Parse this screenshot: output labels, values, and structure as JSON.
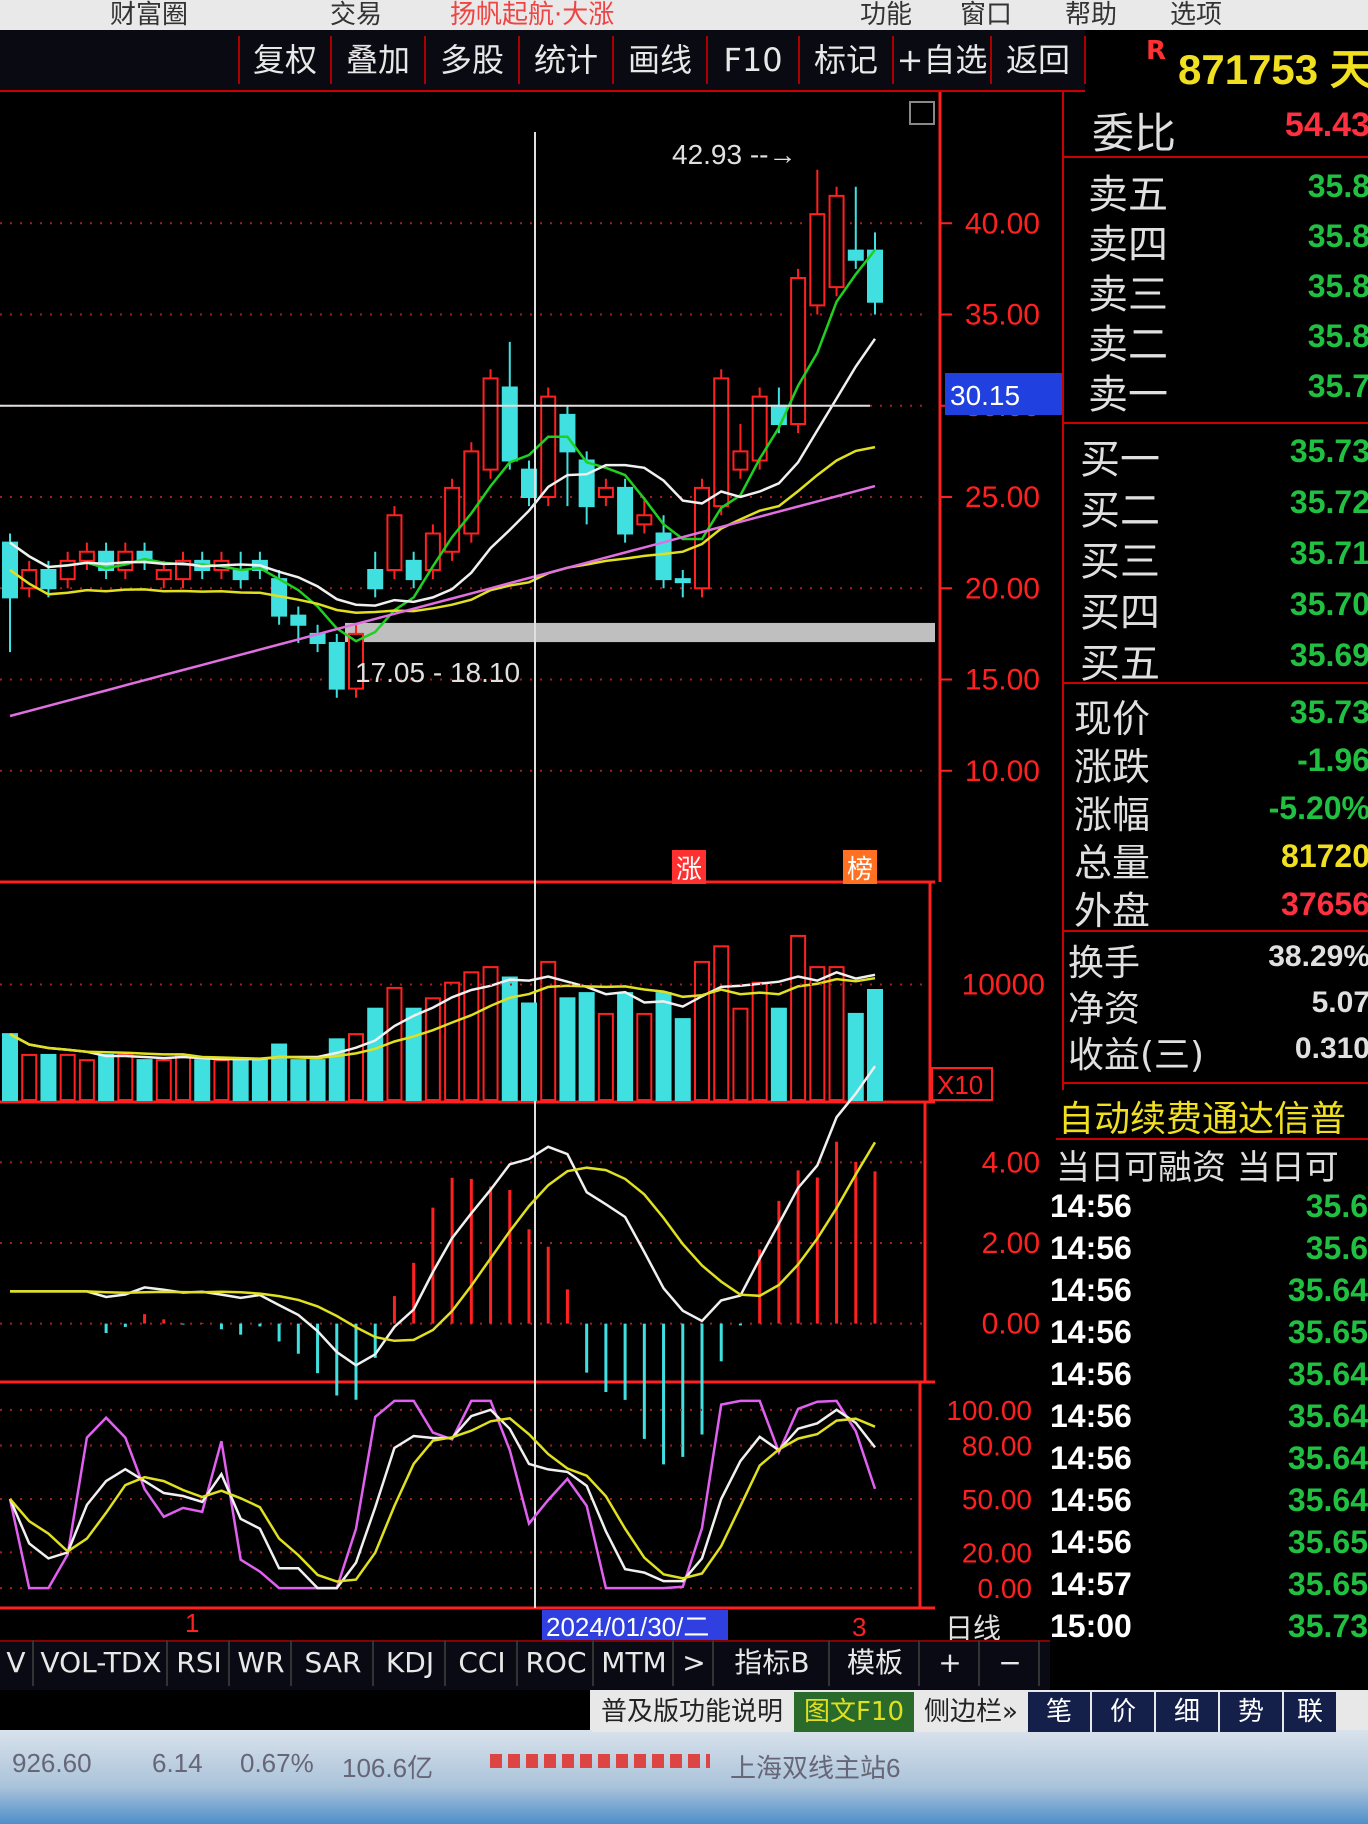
{
  "top_menu": [
    "财富圈",
    "交易",
    "扬帆起航·大涨",
    "功能",
    "窗口",
    "帮助",
    "选项"
  ],
  "toolbar": [
    "复权",
    "叠加",
    "多股",
    "统计",
    "画线",
    "F10",
    "标记",
    "+自选",
    "返回"
  ],
  "stock": {
    "marker": "R",
    "code_name": "871753 天"
  },
  "quote": {
    "weibi_label": "委比",
    "weibi_value": "54.43",
    "sell": [
      {
        "label": "卖五",
        "price": "35.8"
      },
      {
        "label": "卖四",
        "price": "35.8"
      },
      {
        "label": "卖三",
        "price": "35.8"
      },
      {
        "label": "卖二",
        "price": "35.8"
      },
      {
        "label": "卖一",
        "price": "35.7"
      }
    ],
    "buy": [
      {
        "label": "买一",
        "price": "35.73"
      },
      {
        "label": "买二",
        "price": "35.72"
      },
      {
        "label": "买三",
        "price": "35.71"
      },
      {
        "label": "买四",
        "price": "35.70"
      },
      {
        "label": "买五",
        "price": "35.69"
      }
    ],
    "stats": [
      {
        "label": "现价",
        "value": "35.73",
        "color": "#20c040"
      },
      {
        "label": "涨跌",
        "value": "-1.96",
        "color": "#20c040"
      },
      {
        "label": "涨幅",
        "value": "-5.20%",
        "color": "#20c040"
      },
      {
        "label": "总量",
        "value": "81720",
        "color": "#f0e020"
      },
      {
        "label": "外盘",
        "value": "37656",
        "color": "#ff3040"
      }
    ],
    "stats2": [
      {
        "label": "换手",
        "value": "38.29%"
      },
      {
        "label": "净资",
        "value": "5.07"
      },
      {
        "label": "收益(三)",
        "value": "0.310"
      }
    ],
    "banner": "自动续费通达信普",
    "margin_label": "当日可融资 当日可"
  },
  "ticks": [
    {
      "time": "14:56",
      "price": "35.6"
    },
    {
      "time": "14:56",
      "price": "35.6"
    },
    {
      "time": "14:56",
      "price": "35.64"
    },
    {
      "time": "14:56",
      "price": "35.65"
    },
    {
      "time": "14:56",
      "price": "35.64"
    },
    {
      "time": "14:56",
      "price": "35.64"
    },
    {
      "time": "14:56",
      "price": "35.64"
    },
    {
      "time": "14:56",
      "price": "35.64"
    },
    {
      "time": "14:56",
      "price": "35.65"
    },
    {
      "time": "14:57",
      "price": "35.65"
    },
    {
      "time": "15:00",
      "price": "35.73"
    }
  ],
  "chart_data": [
    {
      "type": "candlestick",
      "title": "日线",
      "price_axis": [
        "40.00",
        "35.00",
        "30.00",
        "25.00",
        "20.00",
        "15.00",
        "10.00"
      ],
      "highlight_price": "30.15",
      "peak_label": "42.93",
      "range_label": "17.05 - 18.10",
      "markers": [
        "涨",
        "榜"
      ],
      "candles": [
        {
          "o": 19.5,
          "c": 22.5,
          "h": 23,
          "l": 16.5,
          "up": false
        },
        {
          "o": 20.0,
          "c": 21.0,
          "h": 21.5,
          "l": 19.5,
          "up": true
        },
        {
          "o": 21.0,
          "c": 20.0,
          "h": 21.5,
          "l": 19.5,
          "up": false
        },
        {
          "o": 20.5,
          "c": 21.5,
          "h": 22,
          "l": 20,
          "up": true
        },
        {
          "o": 21.5,
          "c": 22.0,
          "h": 22.5,
          "l": 21,
          "up": true
        },
        {
          "o": 22.0,
          "c": 21.0,
          "h": 22.5,
          "l": 20.5,
          "up": false
        },
        {
          "o": 21.0,
          "c": 22.0,
          "h": 22.5,
          "l": 20.5,
          "up": true
        },
        {
          "o": 22.0,
          "c": 21.5,
          "h": 22.5,
          "l": 21,
          "up": false
        },
        {
          "o": 21.0,
          "c": 20.5,
          "h": 21.5,
          "l": 20,
          "up": true
        },
        {
          "o": 20.5,
          "c": 21.5,
          "h": 22,
          "l": 20,
          "up": true
        },
        {
          "o": 21.5,
          "c": 21.0,
          "h": 22,
          "l": 20.5,
          "up": false
        },
        {
          "o": 21.0,
          "c": 21.5,
          "h": 22,
          "l": 20.5,
          "up": true
        },
        {
          "o": 21.0,
          "c": 20.5,
          "h": 22,
          "l": 20,
          "up": false
        },
        {
          "o": 21.5,
          "c": 21.0,
          "h": 22,
          "l": 20.5,
          "up": false
        },
        {
          "o": 20.5,
          "c": 18.5,
          "h": 21,
          "l": 18,
          "up": false
        },
        {
          "o": 18.5,
          "c": 18.0,
          "h": 19,
          "l": 17,
          "up": false
        },
        {
          "o": 17.5,
          "c": 17.0,
          "h": 18,
          "l": 16.5,
          "up": false
        },
        {
          "o": 17.0,
          "c": 14.5,
          "h": 17.5,
          "l": 14,
          "up": false
        },
        {
          "o": 14.5,
          "c": 17.5,
          "h": 18,
          "l": 14,
          "up": true
        },
        {
          "o": 20.0,
          "c": 21.0,
          "h": 22,
          "l": 19.5,
          "up": false
        },
        {
          "o": 21.0,
          "c": 24.0,
          "h": 24.5,
          "l": 20.5,
          "up": true
        },
        {
          "o": 21.5,
          "c": 20.5,
          "h": 22,
          "l": 20,
          "up": false
        },
        {
          "o": 21.0,
          "c": 23.0,
          "h": 23.5,
          "l": 20.5,
          "up": true
        },
        {
          "o": 22.0,
          "c": 25.5,
          "h": 26,
          "l": 21.5,
          "up": true
        },
        {
          "o": 23.0,
          "c": 27.5,
          "h": 28,
          "l": 22.5,
          "up": true
        },
        {
          "o": 26.5,
          "c": 31.5,
          "h": 32,
          "l": 26,
          "up": true
        },
        {
          "o": 31.0,
          "c": 27.0,
          "h": 33.5,
          "l": 26.5,
          "up": false
        },
        {
          "o": 26.5,
          "c": 25.0,
          "h": 27,
          "l": 24.5,
          "up": false
        },
        {
          "o": 25.0,
          "c": 30.5,
          "h": 31,
          "l": 24.5,
          "up": true
        },
        {
          "o": 29.5,
          "c": 27.5,
          "h": 30,
          "l": 24.5,
          "up": false
        },
        {
          "o": 27.0,
          "c": 24.5,
          "h": 27.5,
          "l": 23.5,
          "up": false
        },
        {
          "o": 25.0,
          "c": 25.5,
          "h": 26,
          "l": 24.5,
          "up": true
        },
        {
          "o": 25.5,
          "c": 23.0,
          "h": 26,
          "l": 22.5,
          "up": false
        },
        {
          "o": 23.5,
          "c": 24.0,
          "h": 25,
          "l": 23,
          "up": true
        },
        {
          "o": 23.0,
          "c": 20.5,
          "h": 24,
          "l": 20,
          "up": false
        },
        {
          "o": 20.5,
          "c": 20.5,
          "h": 21,
          "l": 19.5,
          "up": false
        },
        {
          "o": 20.0,
          "c": 25.5,
          "h": 26,
          "l": 19.5,
          "up": true
        },
        {
          "o": 24.5,
          "c": 31.5,
          "h": 32,
          "l": 24,
          "up": true
        },
        {
          "o": 26.5,
          "c": 27.5,
          "h": 29,
          "l": 26,
          "up": true
        },
        {
          "o": 27.0,
          "c": 30.5,
          "h": 31,
          "l": 26.5,
          "up": true
        },
        {
          "o": 30.0,
          "c": 29.0,
          "h": 31,
          "l": 28.5,
          "up": false
        },
        {
          "o": 29.0,
          "c": 37.0,
          "h": 37.5,
          "l": 28.5,
          "up": true
        },
        {
          "o": 35.5,
          "c": 40.5,
          "h": 42.93,
          "l": 35,
          "up": true
        },
        {
          "o": 36.5,
          "c": 41.5,
          "h": 42,
          "l": 36,
          "up": true
        },
        {
          "o": 38.5,
          "c": 38.0,
          "h": 42,
          "l": 37.5,
          "up": false
        },
        {
          "o": 38.5,
          "c": 35.7,
          "h": 39.5,
          "l": 35,
          "up": false
        }
      ]
    },
    {
      "type": "bar",
      "title": "VOL-TDX",
      "axis": [
        "10000"
      ],
      "unit": "X10"
    },
    {
      "type": "line",
      "title": "MACD",
      "axis": [
        "4.00",
        "2.00",
        "0.00"
      ]
    },
    {
      "type": "line",
      "title": "KDJ",
      "axis": [
        "100.00",
        "80.00",
        "50.00",
        "20.00",
        "0.00"
      ]
    }
  ],
  "date_label": "2024/01/30/二",
  "period_label": "日线",
  "axis_markers": [
    "1",
    "3"
  ],
  "indicator_tabs": [
    "V",
    "VOL-TDX",
    "RSI",
    "WR",
    "SAR",
    "KDJ",
    "CCI",
    "ROC",
    "MTM",
    ">",
    "指标B",
    "模板",
    "+",
    "−"
  ],
  "footer_tabs": [
    "普及版功能说明",
    "图文F10",
    "侧边栏»",
    "笔",
    "价",
    "细",
    "势",
    "联"
  ],
  "status": {
    "index": "926.60",
    "change": "6.14",
    "pct": "0.67%",
    "amount": "106.6亿",
    "site": "上海双线主站6"
  }
}
